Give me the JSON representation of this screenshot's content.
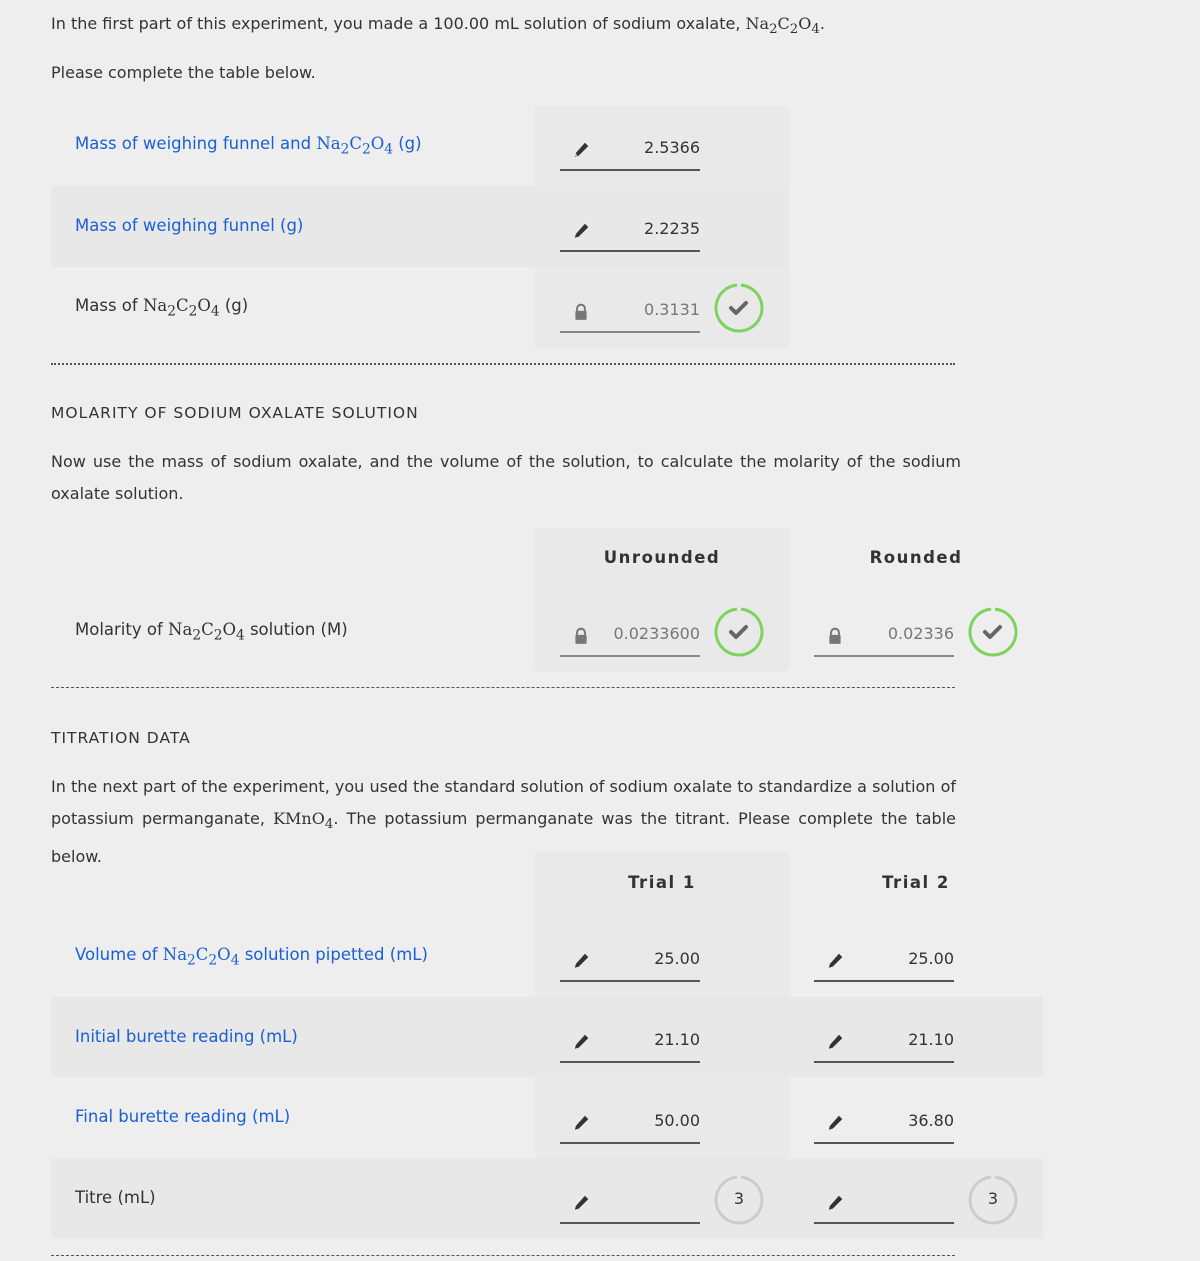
{
  "intro": {
    "text_before": "In the first part of this experiment, you made a 100.00 mL solution of sodium oxalate, ",
    "formula": "Na2C2O4",
    "text_after": ".",
    "instruction": "Please complete the table below."
  },
  "mass_table": {
    "rows": [
      {
        "label_before": "Mass of weighing funnel and ",
        "formula": "Na2C2O4",
        "label_after": " (g)",
        "value": "2.5366",
        "icon": "pencil-icon",
        "editable": true
      },
      {
        "label_before": "Mass of weighing funnel (g)",
        "formula": "",
        "label_after": "",
        "value": "2.2235",
        "icon": "pencil-icon",
        "editable": true
      },
      {
        "label_before": "Mass of ",
        "formula": "Na2C2O4",
        "label_after": " (g)",
        "value": "0.3131",
        "icon": "lock-icon",
        "editable": false,
        "status": "correct"
      }
    ]
  },
  "molarity": {
    "heading": "MOLARITY OF SODIUM OXALATE SOLUTION",
    "description": "Now use the mass of sodium oxalate, and the volume of the solution, to calculate the molarity of the sodium oxalate solution.",
    "columns": [
      "Unrounded",
      "Rounded"
    ],
    "row": {
      "label_before": "Molarity of ",
      "formula": "Na2C2O4",
      "label_after": " solution (M)",
      "unrounded": "0.0233600",
      "rounded": "0.02336",
      "status": "correct"
    }
  },
  "titration": {
    "heading": "TITRATION DATA",
    "description_before": "In the next part of the experiment, you used the standard solution of sodium oxalate to standardize a solution of potassium permanganate, ",
    "formula": "KMnO4",
    "description_after": ". The potassium permanganate was the titrant. Please complete the table below.",
    "columns": [
      "Trial 1",
      "Trial 2"
    ],
    "rows": [
      {
        "label_before": "Volume of ",
        "formula": "Na2C2O4",
        "label_after": " solution pipetted (mL)",
        "trial1": "25.00",
        "trial2": "25.00"
      },
      {
        "label_before": "Initial burette reading (mL)",
        "formula": "",
        "label_after": "",
        "trial1": "21.10",
        "trial2": "21.10"
      },
      {
        "label_before": "Final burette reading (mL)",
        "formula": "",
        "label_after": "",
        "trial1": "50.00",
        "trial2": "36.80"
      },
      {
        "label_before": "Titre (mL)",
        "formula": "",
        "label_after": "",
        "trial1": "",
        "trial2": "",
        "attempts1": "3",
        "attempts2": "3"
      }
    ]
  },
  "colors": {
    "link": "#1a5fd6",
    "correct": "#7ed35e",
    "attempts_ring": "#cccccc"
  }
}
